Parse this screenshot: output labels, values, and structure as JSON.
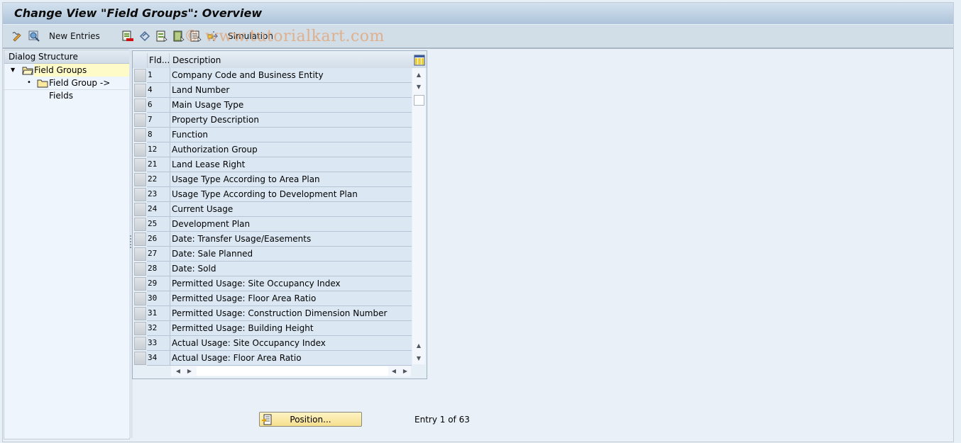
{
  "window": {
    "title": "Change View \"Field Groups\": Overview"
  },
  "toolbar": {
    "items": [
      {
        "name": "change-display-icon",
        "label": ""
      },
      {
        "name": "find-icon",
        "label": ""
      },
      {
        "name": "new-entries-button",
        "label": "New Entries"
      },
      {
        "name": "delete-icon",
        "label": ""
      },
      {
        "name": "undo-change-icon",
        "label": ""
      },
      {
        "name": "select-all-icon",
        "label": ""
      },
      {
        "name": "select-block-icon",
        "label": ""
      },
      {
        "name": "deselect-all-icon",
        "label": ""
      },
      {
        "name": "simulation-icon",
        "label": ""
      }
    ],
    "new_entries_label": "New Entries",
    "simulation_label": "Simulation",
    "watermark": "© www.tutorialkart.com"
  },
  "dialog_structure": {
    "header": "Dialog Structure",
    "items": [
      {
        "label": "Field Groups",
        "selected": true,
        "expanded": true
      },
      {
        "label": "Field Group -> Fields",
        "selected": false
      }
    ]
  },
  "table": {
    "columns": [
      "Fld...",
      "Description"
    ],
    "rows": [
      {
        "fld": "1",
        "desc": "Company Code and Business Entity"
      },
      {
        "fld": "4",
        "desc": "Land Number"
      },
      {
        "fld": "6",
        "desc": "Main Usage Type"
      },
      {
        "fld": "7",
        "desc": "Property Description"
      },
      {
        "fld": "8",
        "desc": "Function"
      },
      {
        "fld": "12",
        "desc": "Authorization Group"
      },
      {
        "fld": "21",
        "desc": "Land Lease Right"
      },
      {
        "fld": "22",
        "desc": "Usage Type According to Area Plan"
      },
      {
        "fld": "23",
        "desc": "Usage Type According to Development Plan"
      },
      {
        "fld": "24",
        "desc": "Current Usage"
      },
      {
        "fld": "25",
        "desc": "Development Plan"
      },
      {
        "fld": "26",
        "desc": "Date: Transfer Usage/Easements"
      },
      {
        "fld": "27",
        "desc": "Date: Sale Planned"
      },
      {
        "fld": "28",
        "desc": "Date: Sold"
      },
      {
        "fld": "29",
        "desc": "Permitted Usage: Site Occupancy Index"
      },
      {
        "fld": "30",
        "desc": "Permitted Usage: Floor Area Ratio"
      },
      {
        "fld": "31",
        "desc": "Permitted Usage: Construction Dimension Number"
      },
      {
        "fld": "32",
        "desc": "Permitted Usage: Building Height"
      },
      {
        "fld": "33",
        "desc": "Actual Usage: Site Occupancy Index"
      },
      {
        "fld": "34",
        "desc": "Actual Usage:  Floor Area Ratio"
      }
    ]
  },
  "footer": {
    "position_button": "Position...",
    "entry_text": "Entry 1 of 63"
  },
  "colors": {
    "selected_tree_item": "#fffbc8",
    "position_button": "#f6df8e"
  }
}
